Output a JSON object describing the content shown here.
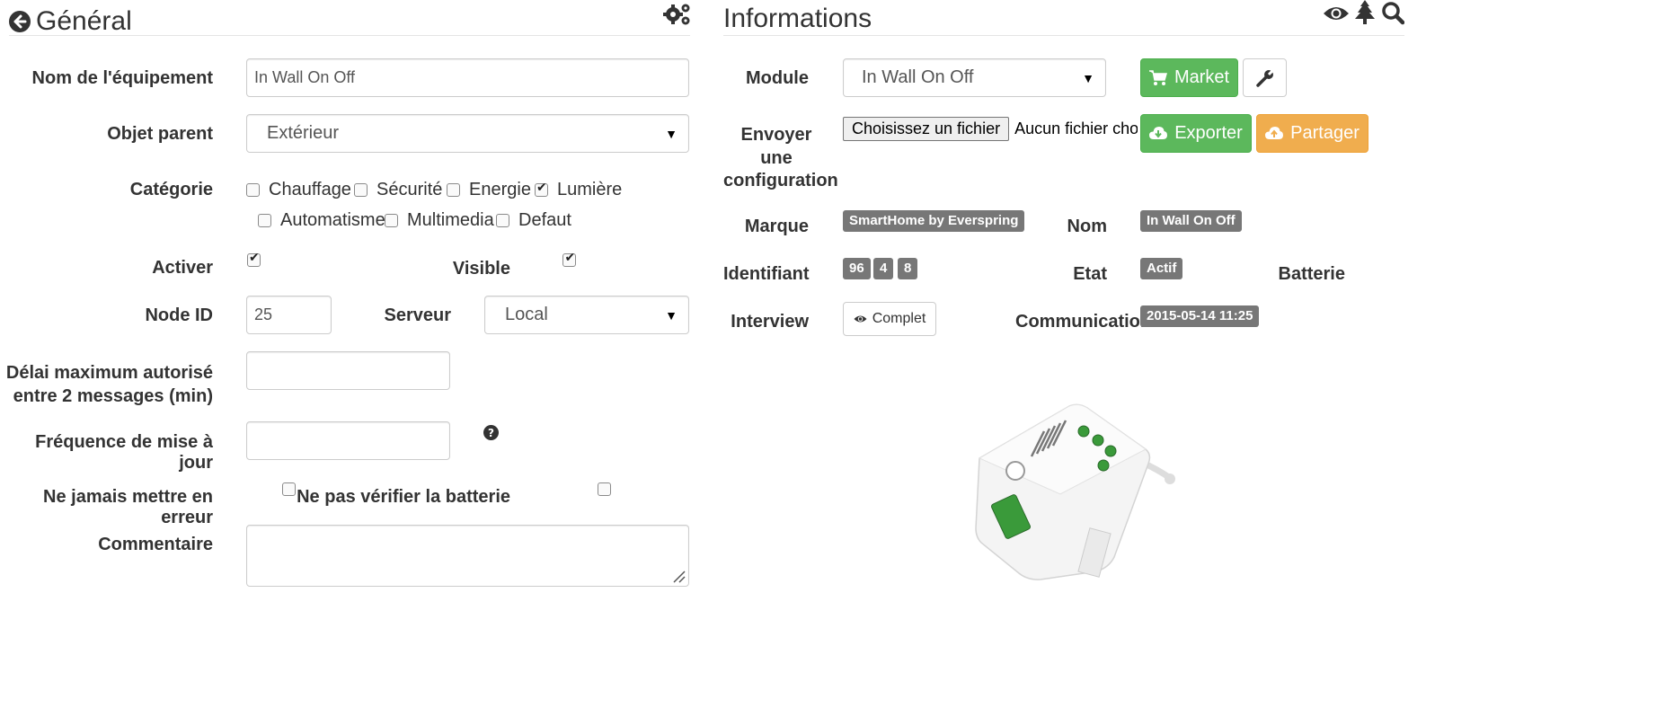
{
  "general": {
    "title": "Général",
    "fields": {
      "equipment_name_label": "Nom de l'équipement",
      "equipment_name_value": "In Wall On Off",
      "parent_label": "Objet parent",
      "parent_value": "Extérieur",
      "category_label": "Catégorie",
      "categories": [
        {
          "label": "Chauffage",
          "checked": false
        },
        {
          "label": "Sécurité",
          "checked": false
        },
        {
          "label": "Energie",
          "checked": false
        },
        {
          "label": "Lumière",
          "checked": true
        },
        {
          "label": "Automatisme",
          "checked": false
        },
        {
          "label": "Multimedia",
          "checked": false
        },
        {
          "label": "Defaut",
          "checked": false
        }
      ],
      "enable_label": "Activer",
      "visible_label": "Visible",
      "node_id_label": "Node ID",
      "node_id_value": "25",
      "server_label": "Serveur",
      "server_value": "Local",
      "max_delay_label_1": "Délai maximum autorisé",
      "max_delay_label_2": "entre 2 messages (min)",
      "update_freq_label": "Fréquence de mise à jour",
      "never_error_label": "Ne jamais mettre en erreur",
      "no_battery_check_label": "Ne pas vérifier la batterie",
      "comment_label": "Commentaire"
    }
  },
  "informations": {
    "title": "Informations",
    "module_label": "Module",
    "module_value": "In Wall On Off",
    "market_button": "Market",
    "send_config_label_1": "Envoyer",
    "send_config_label_2": "une",
    "send_config_label_3": "configuration",
    "choose_file_button": "Choisissez un fichier",
    "no_file_text": "Aucun fichier choisi",
    "export_button": "Exporter",
    "share_button": "Partager",
    "brand_label": "Marque",
    "brand_value": "SmartHome by Everspring",
    "name_label": "Nom",
    "name_value": "In Wall On Off",
    "identifier_label": "Identifiant",
    "identifier_values": [
      "96",
      "4",
      "8"
    ],
    "state_label": "Etat",
    "state_value": "Actif",
    "battery_label": "Batterie",
    "interview_label": "Interview",
    "interview_button": "Complet",
    "communication_label": "Communication",
    "communication_value": "2015-05-14 11:25"
  },
  "colors": {
    "success": "#5cb85c",
    "warning": "#f0ad4e",
    "badge": "#777777"
  },
  "icons": [
    "back-circle-icon",
    "gears-icon",
    "eye-icon",
    "tree-icon",
    "search-icon",
    "cart-icon",
    "wrench-icon",
    "cloud-download-icon",
    "cloud-upload-icon",
    "question-circle-icon",
    "device-image"
  ]
}
